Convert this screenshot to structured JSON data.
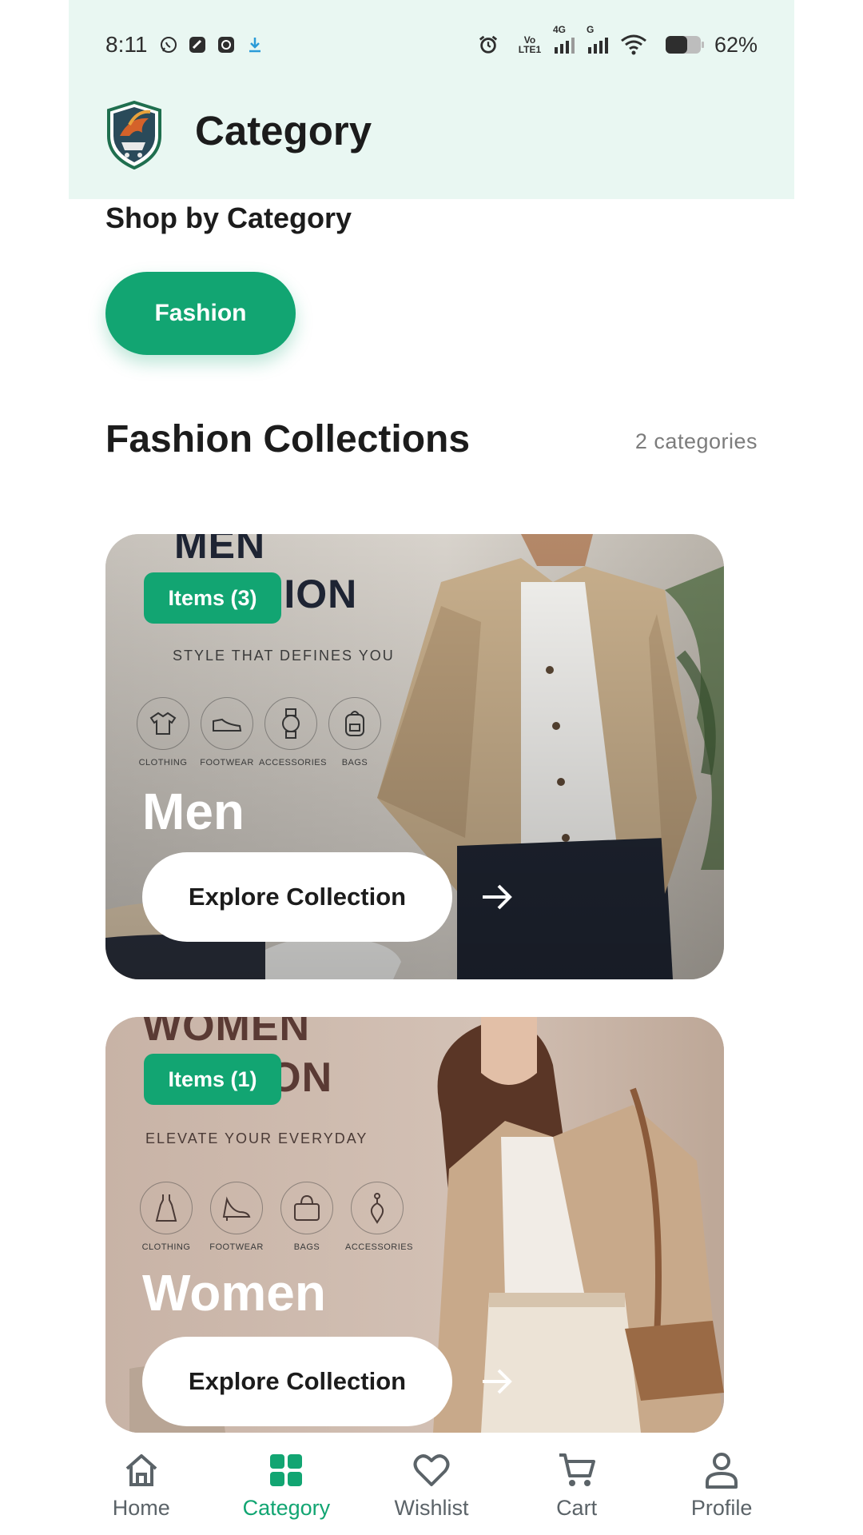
{
  "status_bar": {
    "time": "8:11",
    "battery": "62%",
    "volte": "Vo LTE1",
    "net1": "4G",
    "net2": "G"
  },
  "header": {
    "title": "Category"
  },
  "shop_by": {
    "title": "Shop by Category",
    "chips": [
      {
        "label": "Fashion",
        "selected": true
      }
    ]
  },
  "collections": {
    "title": "Fashion Collections",
    "count_label": "2 categories",
    "items": [
      {
        "name": "Men",
        "badge": "Items (3)",
        "banner_title": "MEN FASHION",
        "tagline": "STYLE THAT DEFINES YOU",
        "features": [
          "CLOTHING",
          "FOOTWEAR",
          "ACCESSORIES",
          "BAGS"
        ],
        "button": "Explore Collection"
      },
      {
        "name": "Women",
        "badge": "Items (1)",
        "banner_title": "WOMEN FASHION",
        "tagline": "ELEVATE YOUR EVERYDAY",
        "features": [
          "CLOTHING",
          "FOOTWEAR",
          "BAGS",
          "ACCESSORIES"
        ],
        "button": "Explore Collection"
      }
    ]
  },
  "bottom_nav": [
    {
      "label": "Home",
      "icon": "home-icon",
      "active": false
    },
    {
      "label": "Category",
      "icon": "grid-icon",
      "active": true
    },
    {
      "label": "Wishlist",
      "icon": "heart-icon",
      "active": false
    },
    {
      "label": "Cart",
      "icon": "cart-icon",
      "active": false
    },
    {
      "label": "Profile",
      "icon": "person-icon",
      "active": false
    }
  ],
  "colors": {
    "accent": "#12a572",
    "header_bg": "#e9f7f2",
    "text_dark": "#1c1c1c",
    "nav_inactive": "#5b6368"
  }
}
